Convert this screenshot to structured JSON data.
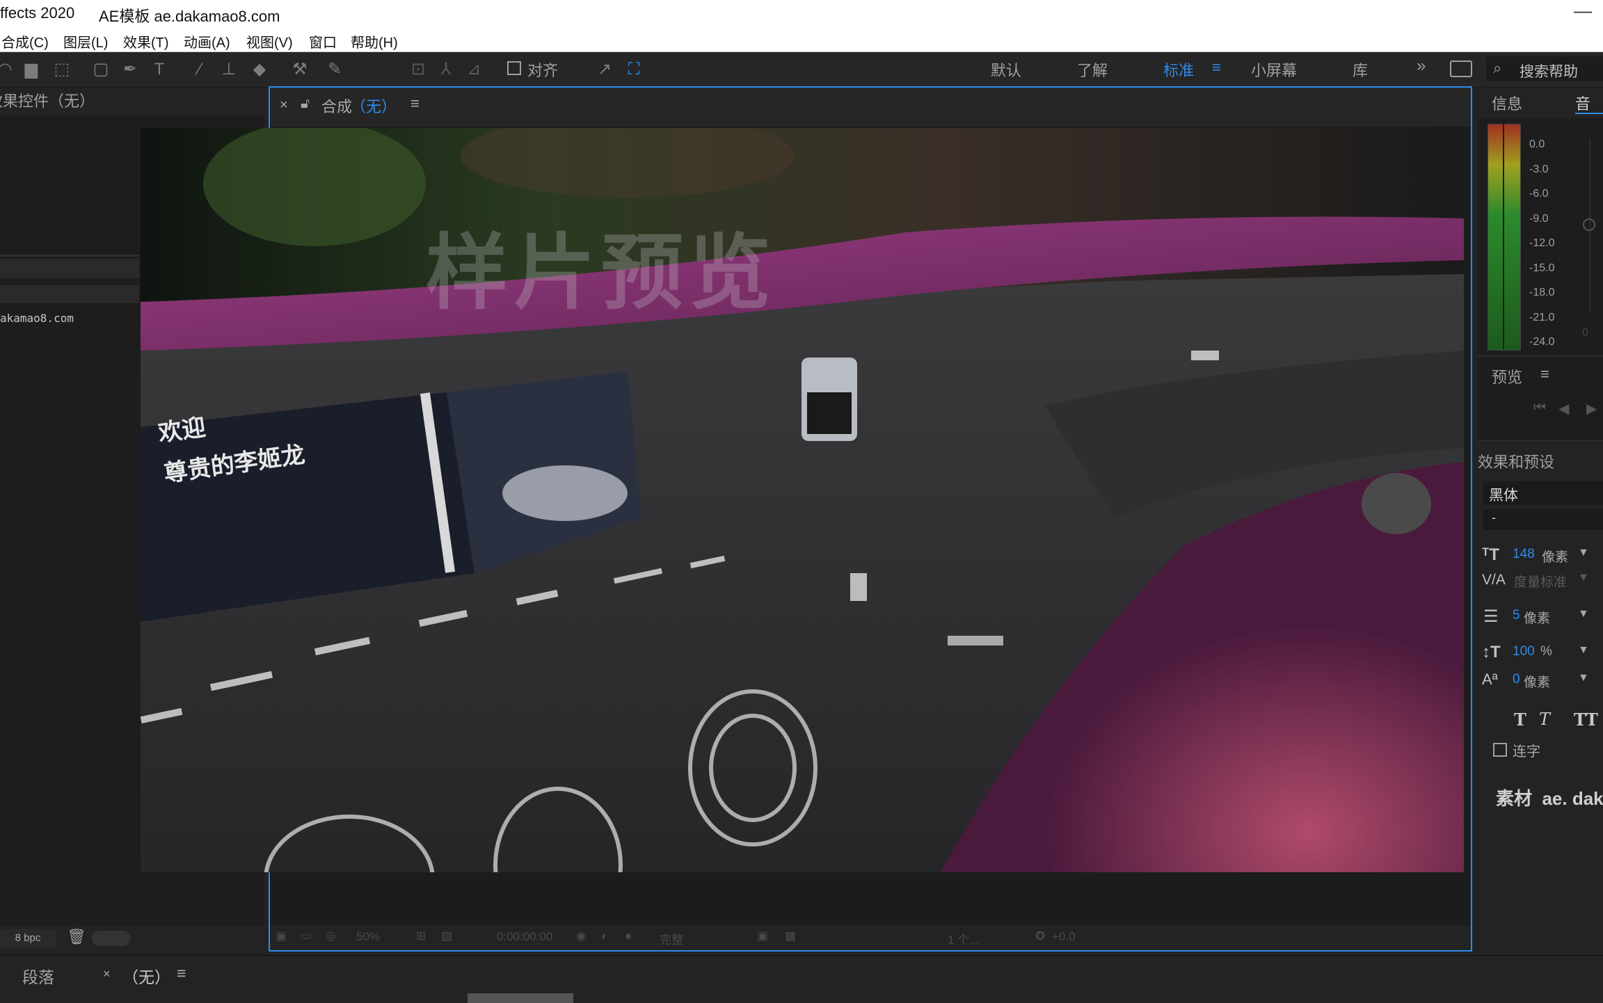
{
  "titlebar": {
    "app_title": "ffects 2020",
    "doc_title": "AE模板 ae.dakamao8.com",
    "minimize": "—"
  },
  "menu": [
    "合成(C)",
    "图层(L)",
    "效果(T)",
    "动画(A)",
    "视图(V)",
    "窗口",
    "帮助(H)"
  ],
  "toolbar": {
    "align_label": "对齐",
    "workspaces": [
      "默认",
      "了解",
      "标准",
      "小屏幕",
      "库"
    ],
    "active_workspace": "标准",
    "more": "»",
    "search_placeholder": "搜索帮助"
  },
  "left_panel": {
    "header": "效果控件（无）",
    "project_item": "akamao8.com",
    "bpc": "8 bpc"
  },
  "comp": {
    "close": "×",
    "tab_name": "合成",
    "tab_comp": "（无）",
    "menu_icon": "≡",
    "watermark": "样片预览",
    "overlay_line1": "欢迎",
    "overlay_line2": "尊贵的李姬龙",
    "footer": {
      "zoom": "50%",
      "timecode": "0:00:00:00",
      "resolution": "完整",
      "views": "1 个...",
      "exposure": "+0.0"
    }
  },
  "right_panel": {
    "tab_info": "信息",
    "tab_audio": "音频",
    "meter_labels": [
      "0.0",
      "-3.0",
      "-6.0",
      "-9.0",
      "-12.0",
      "-15.0",
      "-18.0",
      "-21.0",
      "-24.0"
    ],
    "meter_right_zero": "0",
    "preview_title": "预览",
    "effects_title": "效果和预设",
    "font_name": "黑体",
    "font_style": "-",
    "font_size_value": "148",
    "font_size_unit": "像素",
    "kerning": "度量标准",
    "leading_value": "5",
    "leading_unit": "像素",
    "vscale_value": "100",
    "vscale_unit": "%",
    "baseline_value": "0",
    "baseline_unit": "像素",
    "ligature_label": "连字",
    "footer_text": "素材  ae. dak"
  },
  "bottom": {
    "tab_paragraph": "段落",
    "tab_close": "×",
    "tab_none": "（无）",
    "tab_menu": "≡"
  },
  "colors": {
    "accent": "#2d8ceb",
    "bg": "#232323",
    "panel": "#1d1d1d"
  }
}
